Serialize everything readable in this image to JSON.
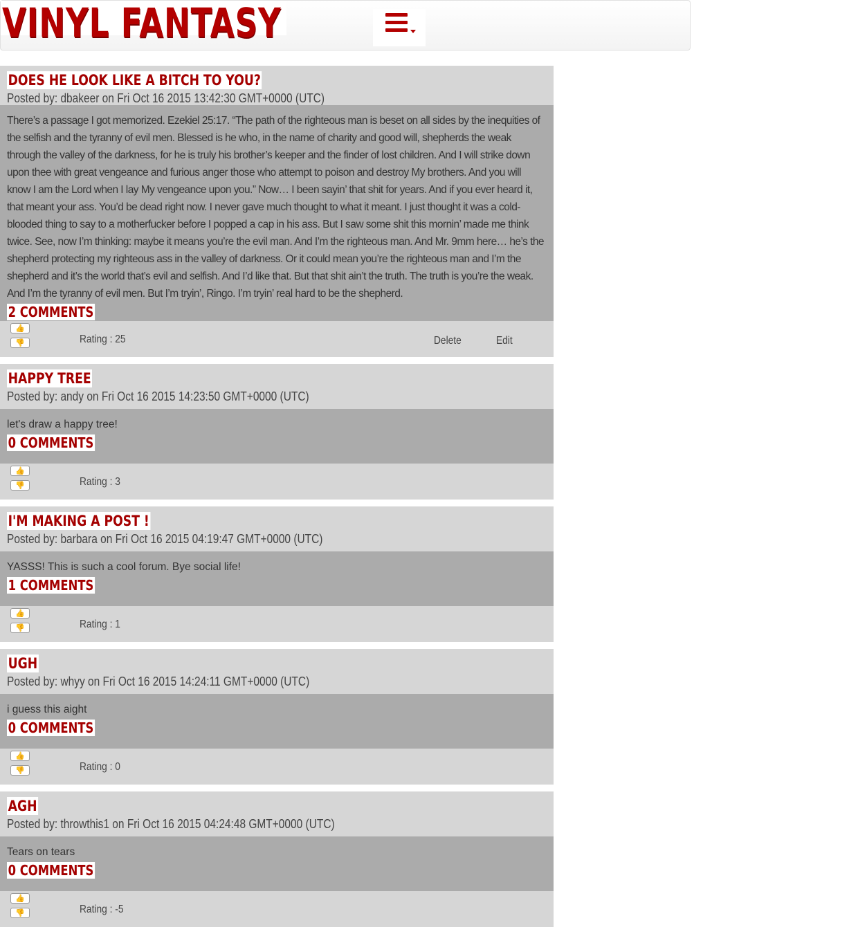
{
  "header": {
    "brand": "VINYL FANTASY",
    "menu_icon": "hamburger-menu-icon"
  },
  "posts": [
    {
      "title": "Does he look like a bitch to you?",
      "meta": "Posted by: dbakeer on Fri Oct 16 2015 13:42:30 GMT+0000 (UTC)",
      "body": "There’s a passage I got memorized. Ezekiel 25:17. “The path of the righteous man is beset on all sides by the inequities of the selfish and the tyranny of evil men. Blessed is he who, in the name of charity and good will, shepherds the weak through the valley of the darkness, for he is truly his brother’s keeper and the finder of lost children. And I will strike down upon thee with great vengeance and furious anger those who attempt to poison and destroy My brothers. And you will know I am the Lord when I lay My vengeance upon you.” Now… I been sayin’ that shit for years. And if you ever heard it, that meant your ass. You’d be dead right now. I never gave much thought to what it meant. I just thought it was a cold-blooded thing to say to a motherfucker before I popped a cap in his ass. But I saw some shit this mornin’ made me think twice. See, now I’m thinking: maybe it means you’re the evil man. And I’m the righteous man. And Mr. 9mm here… he’s the shepherd protecting my righteous ass in the valley of darkness. Or it could mean you’re the righteous man and I’m the shepherd and it’s the world that’s evil and selfish. And I’d like that. But that shit ain’t the truth. The truth is you’re the weak. And I’m the tyranny of evil men. But I’m tryin’, Ringo. I’m tryin’ real hard to be the shepherd.",
      "comments": "2 comments",
      "rating": "Rating : 25",
      "delete_label": "Delete",
      "edit_label": "Edit"
    },
    {
      "title": "Happy tree",
      "meta": "Posted by: andy on Fri Oct 16 2015 14:23:50 GMT+0000 (UTC)",
      "body": "let's draw a happy tree!",
      "comments": "0 comments",
      "rating": "Rating : 3"
    },
    {
      "title": "I'm making a post !",
      "meta": "Posted by: barbara on Fri Oct 16 2015 04:19:47 GMT+0000 (UTC)",
      "body": "YASSS! This is such a cool forum. Bye social life!",
      "comments": "1 comments",
      "rating": "Rating : 1"
    },
    {
      "title": "ugh",
      "meta": "Posted by: whyy on Fri Oct 16 2015 14:24:11 GMT+0000 (UTC)",
      "body": "i guess this aight",
      "comments": "0 comments",
      "rating": "Rating : 0"
    },
    {
      "title": "agh",
      "meta": "Posted by: throwthis1 on Fri Oct 16 2015 04:24:48 GMT+0000 (UTC)",
      "body": "Tears on tears",
      "comments": "0 comments",
      "rating": "Rating : -5"
    }
  ],
  "icons": {
    "upvote": "thumbs-up-icon",
    "downvote": "thumbs-down-icon"
  }
}
